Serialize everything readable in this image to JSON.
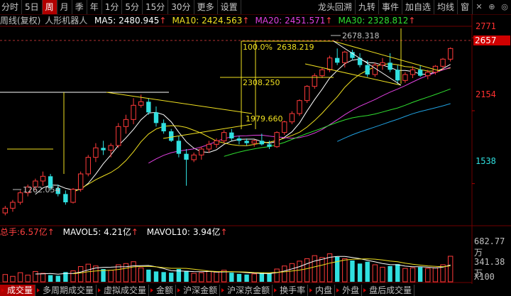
{
  "toolbar": {
    "items": [
      "分时",
      "5日",
      "周",
      "月",
      "季",
      "年",
      "1分",
      "5分",
      "15分",
      "30分",
      "更多",
      "设置"
    ],
    "active_index": 2,
    "right_items": [
      "龙头回溯",
      "九转",
      "事件",
      "加自选",
      "均线",
      "窗"
    ]
  },
  "chart_title": "周线(复权)",
  "stock_name": "人形机器人",
  "ma": [
    {
      "label": "MA5:",
      "value": "2480.945",
      "arrow": "↑",
      "color": "#ffffff"
    },
    {
      "label": "MA10:",
      "value": "2424.563",
      "arrow": "↑",
      "color": "#f0e020"
    },
    {
      "label": "MA20:",
      "value": "2451.571",
      "arrow": "↑",
      "color": "#e040e0"
    },
    {
      "label": "MA30:",
      "value": "2328.812",
      "arrow": "↑",
      "color": "#30e030"
    }
  ],
  "y_axis": {
    "ticks": [
      "2771",
      "2154",
      "1538"
    ],
    "current_price": "2657"
  },
  "annotations": {
    "high": "2678.318",
    "low": "1262.054",
    "fib_top": "100.0%",
    "fib_top_value": "2638.219",
    "level_2308": "2308.250",
    "level_1979": "1979.660"
  },
  "volume": {
    "label": "总手:",
    "total": "6.57亿",
    "total_arrow": "↑",
    "mavol5_label": "MAVOL5:",
    "mavol5": "4.21亿",
    "mavol5_arrow": "↑",
    "mavol10_label": "MAVOL10:",
    "mavol10": "3.94亿",
    "mavol10_arrow": "↑",
    "axis_top": "682.77万",
    "axis_mid": "341.38万",
    "unit": "X100"
  },
  "bottom_tabs": [
    "成交量",
    "多周期成交量",
    "虚拟成交量",
    "金额",
    "沪深金额",
    "沪深京金额",
    "换手率",
    "内盘",
    "外盘",
    "盘后成交量"
  ],
  "bottom_active_index": 0,
  "colors": {
    "up": "#ff3a3a",
    "down": "#30e0e0",
    "ma5": "#ffffff",
    "ma10": "#f0e020",
    "ma20": "#e040e0",
    "ma30": "#30e030",
    "ma60": "#20a0e0",
    "accent_red": "#b00000"
  },
  "chart_data": {
    "type": "candlestick",
    "title": "周线(复权)",
    "ylim": [
      1200,
      2850
    ],
    "ohlc": [
      [
        1290,
        1350,
        1270,
        1330
      ],
      [
        1330,
        1400,
        1300,
        1380
      ],
      [
        1380,
        1480,
        1360,
        1460
      ],
      [
        1460,
        1530,
        1430,
        1510
      ],
      [
        1510,
        1580,
        1480,
        1560
      ],
      [
        1560,
        1640,
        1520,
        1600
      ],
      [
        1600,
        1620,
        1480,
        1500
      ],
      [
        1500,
        1530,
        1430,
        1450
      ],
      [
        1450,
        1480,
        1360,
        1380
      ],
      [
        1380,
        1500,
        1370,
        1490
      ],
      [
        1490,
        1640,
        1470,
        1620
      ],
      [
        1620,
        1780,
        1600,
        1760
      ],
      [
        1760,
        1880,
        1720,
        1840
      ],
      [
        1840,
        1900,
        1780,
        1820
      ],
      [
        1820,
        1880,
        1760,
        1860
      ],
      [
        1860,
        2050,
        1840,
        2020
      ],
      [
        2020,
        2120,
        1960,
        2080
      ],
      [
        2080,
        2260,
        2040,
        2200
      ],
      [
        2200,
        2290,
        2180,
        2230
      ],
      [
        2230,
        2260,
        2120,
        2140
      ],
      [
        2140,
        2190,
        2020,
        2050
      ],
      [
        2050,
        2080,
        1960,
        1980
      ],
      [
        1980,
        2000,
        1890,
        1900
      ],
      [
        1900,
        1940,
        1760,
        1790
      ],
      [
        1790,
        1830,
        1520,
        1740
      ],
      [
        1740,
        1800,
        1720,
        1780
      ],
      [
        1780,
        1850,
        1740,
        1830
      ],
      [
        1830,
        1900,
        1800,
        1870
      ],
      [
        1870,
        1920,
        1840,
        1900
      ],
      [
        1900,
        1990,
        1880,
        1970
      ],
      [
        1970,
        2000,
        1900,
        1920
      ],
      [
        1920,
        1940,
        1870,
        1900
      ],
      [
        1900,
        1920,
        1860,
        1880
      ],
      [
        1880,
        1910,
        1850,
        1900
      ],
      [
        1900,
        1960,
        1860,
        1870
      ],
      [
        1870,
        1900,
        1830,
        1850
      ],
      [
        1850,
        1980,
        1840,
        1970
      ],
      [
        1970,
        2070,
        1950,
        2060
      ],
      [
        2060,
        2150,
        2040,
        2130
      ],
      [
        2130,
        2250,
        2110,
        2240
      ],
      [
        2240,
        2370,
        2220,
        2360
      ],
      [
        2360,
        2470,
        2340,
        2450
      ],
      [
        2450,
        2520,
        2430,
        2500
      ],
      [
        2500,
        2620,
        2480,
        2600
      ],
      [
        2600,
        2680,
        2540,
        2560
      ],
      [
        2560,
        2660,
        2520,
        2650
      ],
      [
        2650,
        2670,
        2580,
        2600
      ],
      [
        2600,
        2640,
        2520,
        2540
      ],
      [
        2540,
        2580,
        2440,
        2460
      ],
      [
        2460,
        2560,
        2440,
        2540
      ],
      [
        2540,
        2600,
        2500,
        2560
      ],
      [
        2560,
        2640,
        2480,
        2500
      ],
      [
        2500,
        2540,
        2380,
        2410
      ],
      [
        2410,
        2480,
        2390,
        2460
      ],
      [
        2460,
        2530,
        2430,
        2500
      ],
      [
        2500,
        2540,
        2440,
        2450
      ],
      [
        2450,
        2500,
        2420,
        2480
      ],
      [
        2480,
        2540,
        2460,
        2530
      ],
      [
        2530,
        2600,
        2500,
        2590
      ],
      [
        2590,
        2690,
        2570,
        2680
      ]
    ],
    "volume": [
      120,
      90,
      150,
      110,
      170,
      140,
      110,
      100,
      160,
      180,
      250,
      290,
      260,
      210,
      190,
      280,
      300,
      330,
      230,
      200,
      170,
      160,
      150,
      210,
      180,
      140,
      150,
      170,
      160,
      190,
      150,
      130,
      120,
      130,
      150,
      140,
      210,
      260,
      300,
      340,
      380,
      430,
      400,
      460,
      410,
      380,
      350,
      300,
      330,
      280,
      240,
      260,
      290,
      220,
      230,
      240,
      220,
      230,
      280,
      420
    ]
  }
}
